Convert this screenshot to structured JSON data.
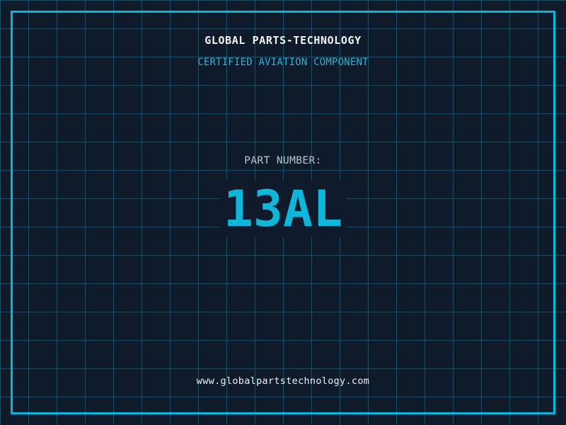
{
  "header": {
    "title": "GLOBAL PARTS-TECHNOLOGY",
    "subtitle": "CERTIFIED AVIATION COMPONENT"
  },
  "part": {
    "label": "PART NUMBER:",
    "number": "13AL"
  },
  "footer": {
    "url": "www.globalpartstechnology.com"
  },
  "colors": {
    "background": "#0f1a2a",
    "grid-line": "#1d4e63",
    "frame": "#05b7da",
    "title": "#f2f5f6",
    "subtitle": "#2fb2d5",
    "label": "#bcc5cc",
    "part-number": "#0fb6d9",
    "url-text": "#edf1f2"
  }
}
